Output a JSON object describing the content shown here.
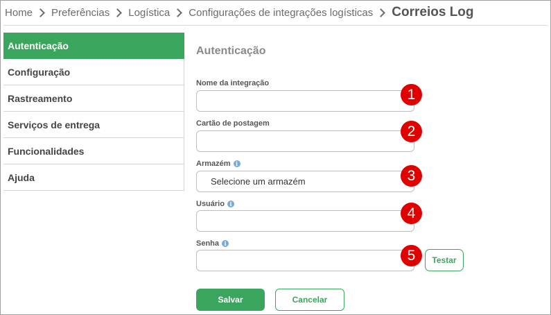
{
  "breadcrumb": {
    "items": [
      "Home",
      "Preferências",
      "Logística",
      "Configurações de integrações logísticas"
    ],
    "current": "Correios Log"
  },
  "sidebar": {
    "items": [
      {
        "label": "Autenticação",
        "active": true
      },
      {
        "label": "Configuração",
        "active": false
      },
      {
        "label": "Rastreamento",
        "active": false
      },
      {
        "label": "Serviços de entrega",
        "active": false
      },
      {
        "label": "Funcionalidades",
        "active": false
      },
      {
        "label": "Ajuda",
        "active": false
      }
    ]
  },
  "form": {
    "title": "Autenticação",
    "fields": {
      "integration_name": {
        "label": "Nome da integração",
        "value": "",
        "marker": "1"
      },
      "posting_card": {
        "label": "Cartão de postagem",
        "value": "",
        "marker": "2"
      },
      "warehouse": {
        "label": "Armazém",
        "selected": "Selecione um armazém",
        "marker": "3",
        "info_icon": "i"
      },
      "user": {
        "label": "Usuário",
        "value": "",
        "marker": "4",
        "info_icon": "i"
      },
      "password": {
        "label": "Senha",
        "value": "",
        "marker": "5",
        "info_icon": "i"
      }
    },
    "test_button": "Testar",
    "save_button": "Salvar",
    "cancel_button": "Cancelar"
  },
  "colors": {
    "accent": "#3aa65d",
    "marker": "#e00000",
    "info": "#7aa9d3"
  }
}
